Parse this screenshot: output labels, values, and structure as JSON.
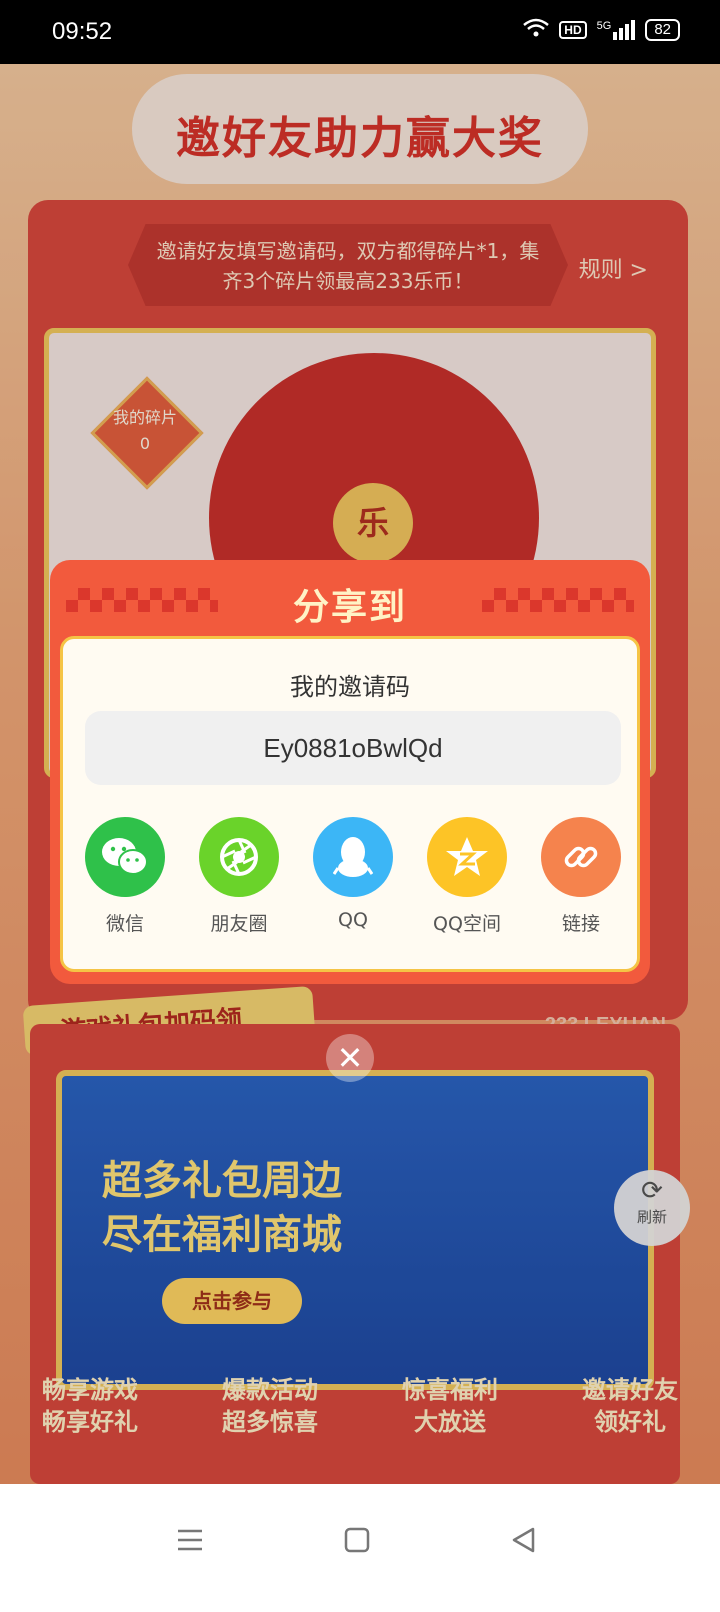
{
  "status_bar": {
    "time": "09:52",
    "network_badge": "HD",
    "signal_label": "5G",
    "battery": "82"
  },
  "page": {
    "banner_title": "邀好友助力赢大奖",
    "rules_text": "邀请好友填写邀请码，双方都得碎片*1，集齐3个碎片领最高233乐币！",
    "rules_link": "规则 >",
    "shard_label": "我的碎片",
    "shard_count": "0",
    "wheel_center": "乐",
    "gift_section_title": "游戏礼包加码领",
    "leyuan_label": "233 LEYUAN",
    "promo_headline_1": "超多礼包周边",
    "promo_headline_2": "尽在福利商城",
    "promo_button": "点击参与",
    "features": [
      {
        "line1": "畅享游戏",
        "line2": "畅享好礼"
      },
      {
        "line1": "爆款活动",
        "line2": "超多惊喜"
      },
      {
        "line1": "惊喜福利",
        "line2": "大放送"
      },
      {
        "line1": "邀请好友",
        "line2": "领好礼"
      }
    ],
    "refresh_label": "刷新"
  },
  "modal": {
    "title": "分享到",
    "code_label": "我的邀请码",
    "invite_code": "Ey0881oBwlQd",
    "share_options": [
      {
        "label": "微信",
        "icon": "wechat-icon",
        "color": "#2fc14a"
      },
      {
        "label": "朋友圈",
        "icon": "moments-icon",
        "color": "#6ad32a"
      },
      {
        "label": "QQ",
        "icon": "qq-icon",
        "color": "#3cb6f6"
      },
      {
        "label": "QQ空间",
        "icon": "qzone-icon",
        "color": "#fdc426"
      },
      {
        "label": "链接",
        "icon": "link-icon",
        "color": "#f5834d"
      }
    ],
    "close_glyph": "✕"
  },
  "colors": {
    "modal_bg": "#f25a3d",
    "accent_gold": "#f5c445",
    "title_text": "#fff3c6"
  }
}
